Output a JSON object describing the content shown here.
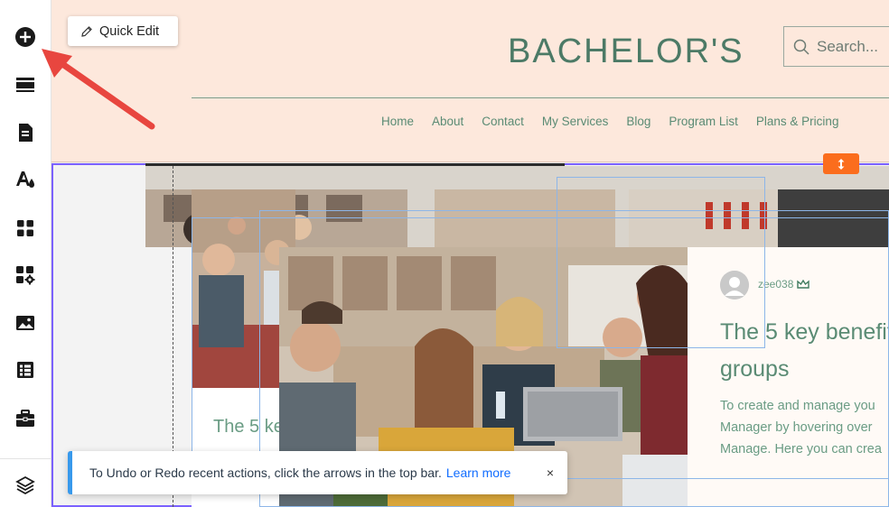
{
  "sidebar": {
    "tools": [
      {
        "name": "add-icon"
      },
      {
        "name": "sections-icon"
      },
      {
        "name": "pages-icon"
      },
      {
        "name": "design-icon"
      },
      {
        "name": "apps-icon"
      },
      {
        "name": "app-market-icon"
      },
      {
        "name": "media-icon"
      },
      {
        "name": "cms-icon"
      },
      {
        "name": "business-icon"
      },
      {
        "name": "layers-icon"
      }
    ]
  },
  "editor": {
    "quick_edit_label": "Quick Edit"
  },
  "site": {
    "logo": "BACHELOR'S",
    "search_placeholder": "Search...",
    "nav": [
      "Home",
      "About",
      "Contact",
      "My Services",
      "Blog",
      "Program List",
      "Plans & Pricing"
    ]
  },
  "post": {
    "author": "zee038",
    "title_line1": "The 5 key benefit",
    "title_line2": "groups",
    "left_card_title": "The 5 ke",
    "body_lines": [
      "To create and manage you",
      "Manager by hovering over",
      "Manage. Here you can crea"
    ]
  },
  "toast": {
    "message": "To Undo or Redo recent actions, click the arrows in the top bar.",
    "link": "Learn more",
    "close": "×"
  },
  "colors": {
    "accent_orange": "#fb6d1d",
    "selection_purple": "#7b61ff",
    "brand_green": "#4c7a66",
    "header_bg": "#fde8dc",
    "annotation_arrow": "#e8463f"
  }
}
